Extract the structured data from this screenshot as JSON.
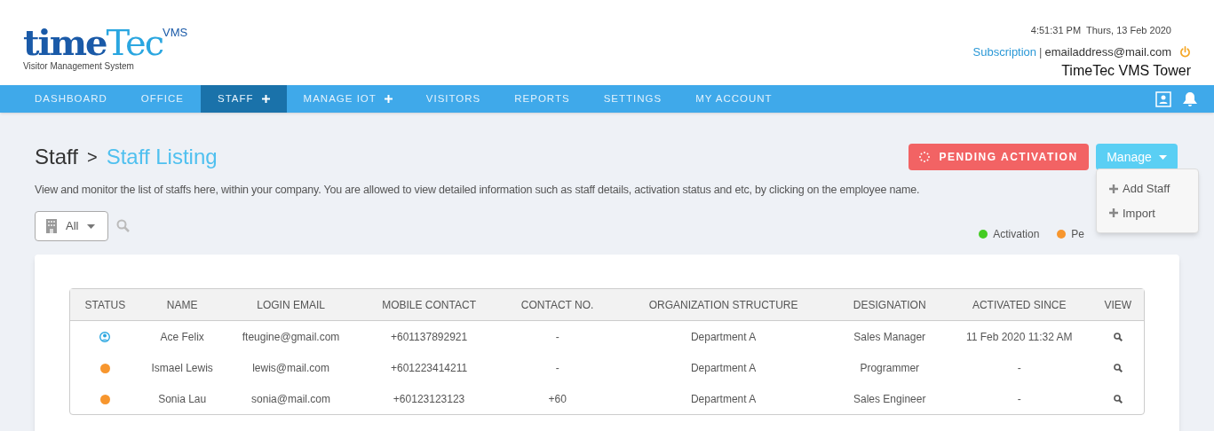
{
  "logo": {
    "wordmark_dark": "time",
    "wordmark_light": "Tec",
    "superscript": "VMS",
    "tagline": "Visitor Management System"
  },
  "header": {
    "datetime": "4:51:31 PM  Thurs, 13 Feb 2020",
    "subscription_link": "Subscription",
    "separator": "|",
    "email": "emailaddress@mail.com",
    "company": "TimeTec VMS Tower"
  },
  "nav": [
    {
      "label": "DASHBOARD",
      "selected": false,
      "expandable": false
    },
    {
      "label": "OFFICE",
      "selected": false,
      "expandable": false
    },
    {
      "label": "STAFF",
      "selected": true,
      "expandable": true
    },
    {
      "label": "MANAGE IOT",
      "selected": false,
      "expandable": true
    },
    {
      "label": "VISITORS",
      "selected": false,
      "expandable": false
    },
    {
      "label": "REPORTS",
      "selected": false,
      "expandable": false
    },
    {
      "label": "SETTINGS",
      "selected": false,
      "expandable": false
    },
    {
      "label": "MY ACCOUNT",
      "selected": false,
      "expandable": false
    }
  ],
  "breadcrumb": {
    "parent": "Staff",
    "separator": ">",
    "current": "Staff Listing"
  },
  "description": "View and monitor the list of staffs here, within your company. You are allowed to view detailed information such as staff details, activation status and etc, by clicking on the employee name.",
  "pending_button": "PENDING ACTIVATION",
  "manage_button": "Manage",
  "manage_menu": [
    "Add Staff",
    "Import"
  ],
  "filter": {
    "value": "All"
  },
  "legend": [
    {
      "label": "Activation",
      "color": "#44cc22"
    },
    {
      "label": "Pe",
      "color": "#f7962e"
    }
  ],
  "table": {
    "columns": [
      "STATUS",
      "NAME",
      "LOGIN EMAIL",
      "MOBILE CONTACT",
      "CONTACT NO.",
      "ORGANIZATION STRUCTURE",
      "DESIGNATION",
      "ACTIVATED SINCE",
      "VIEW"
    ],
    "rows": [
      {
        "status": {
          "kind": "activated_user"
        },
        "cells": [
          "",
          "Ace Felix",
          "fteugine@gmail.com",
          "+601137892921",
          "-",
          "Department A",
          "Sales Manager",
          "11 Feb 2020 11:32 AM"
        ]
      },
      {
        "status": {
          "kind": "dot",
          "color": "#f7962e"
        },
        "cells": [
          "",
          "Ismael Lewis",
          "lewis@mail.com",
          "+601223414211",
          "-",
          "Department A",
          "Programmer",
          "-"
        ]
      },
      {
        "status": {
          "kind": "dot",
          "color": "#f7962e"
        },
        "cells": [
          "",
          "Sonia Lau",
          "sonia@mail.com",
          "+60123123123",
          "+60",
          "Department A",
          "Sales Engineer",
          "-"
        ]
      }
    ]
  }
}
